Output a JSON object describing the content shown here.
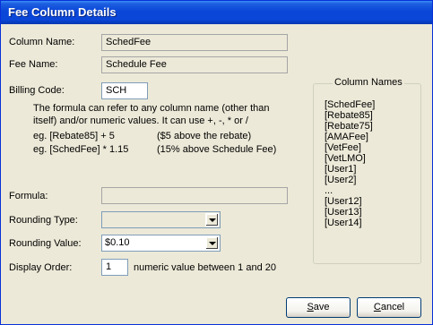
{
  "window": {
    "title": "Fee Column Details"
  },
  "form": {
    "column_name_label": "Column Name:",
    "column_name_value": "SchedFee",
    "fee_name_label": "Fee Name:",
    "fee_name_value": "Schedule Fee",
    "billing_code_label": "Billing Code:",
    "billing_code_value": "SCH",
    "help_line1": "The formula can refer to any column name (other than",
    "help_line2": "itself) and/or numeric values.  It can use +, -, * or /",
    "example1_formula": "eg.  [Rebate85] + 5",
    "example1_note": "($5 above the rebate)",
    "example2_formula": "eg.  [SchedFee] * 1.15",
    "example2_note": "(15% above Schedule Fee)",
    "formula_label": "Formula:",
    "formula_value": "",
    "rounding_type_label": "Rounding Type:",
    "rounding_type_value": "",
    "rounding_value_label": "Rounding Value:",
    "rounding_value_value": "$0.10",
    "display_order_label": "Display Order:",
    "display_order_value": "1",
    "display_order_hint": "numeric value between 1 and 20"
  },
  "column_names": {
    "title": "Column Names",
    "items": [
      "[SchedFee]",
      "[Rebate85]",
      "[Rebate75]",
      "[AMAFee]",
      "[VetFee]",
      "[VetLMO]",
      "[User1]",
      "[User2]",
      "...",
      "[User12]",
      "[User13]",
      "[User14]"
    ]
  },
  "buttons": {
    "save_first": "S",
    "save_rest": "ave",
    "cancel_first": "C",
    "cancel_rest": "ancel"
  }
}
